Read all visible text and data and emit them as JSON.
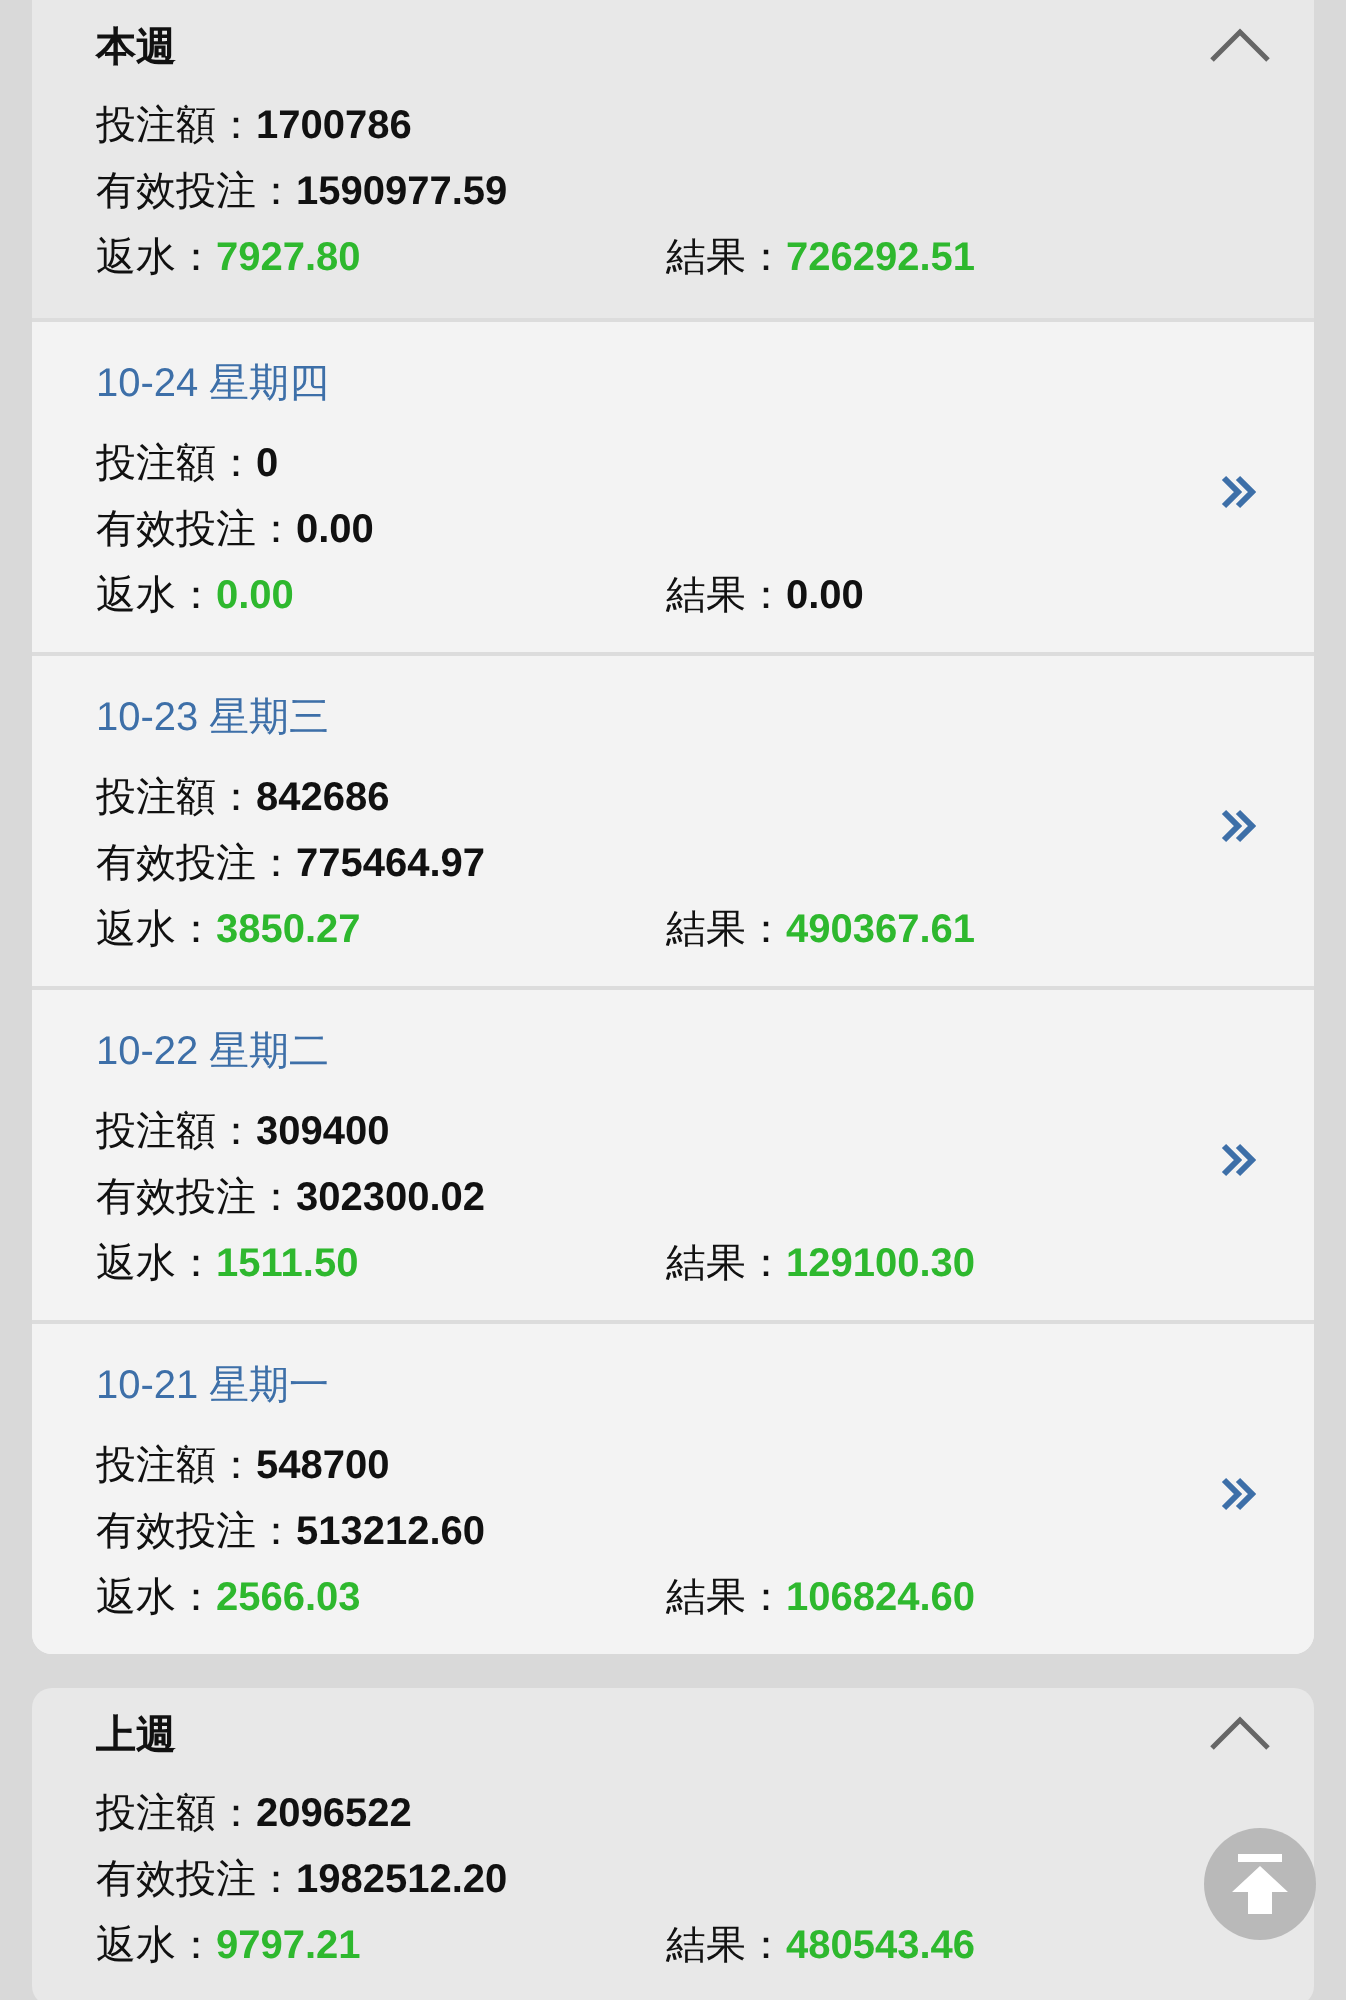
{
  "weeks": [
    {
      "title": "本週",
      "expanded": true,
      "summary": [
        [
          {
            "label": "投注額：",
            "value": "1700786",
            "color": "#111111"
          }
        ],
        [
          {
            "label": "有效投注：",
            "value": "1590977.59",
            "color": "#111111"
          }
        ],
        [
          {
            "label": "返水：",
            "value": "7927.80",
            "color": "#2eb82e"
          },
          {
            "label": "結果：",
            "value": "726292.51",
            "color": "#2eb82e"
          }
        ]
      ],
      "days": [
        {
          "date": "10-24 星期四",
          "rows": [
            [
              {
                "label": "投注額：",
                "value": "0",
                "color": "#111111"
              }
            ],
            [
              {
                "label": "有效投注：",
                "value": "0.00",
                "color": "#111111"
              }
            ],
            [
              {
                "label": "返水：",
                "value": "0.00",
                "color": "#2eb82e"
              },
              {
                "label": "結果：",
                "value": "0.00",
                "color": "#111111"
              }
            ]
          ]
        },
        {
          "date": "10-23 星期三",
          "rows": [
            [
              {
                "label": "投注額：",
                "value": "842686",
                "color": "#111111"
              }
            ],
            [
              {
                "label": "有效投注：",
                "value": "775464.97",
                "color": "#111111"
              }
            ],
            [
              {
                "label": "返水：",
                "value": "3850.27",
                "color": "#2eb82e"
              },
              {
                "label": "結果：",
                "value": "490367.61",
                "color": "#2eb82e"
              }
            ]
          ]
        },
        {
          "date": "10-22 星期二",
          "rows": [
            [
              {
                "label": "投注額：",
                "value": "309400",
                "color": "#111111"
              }
            ],
            [
              {
                "label": "有效投注：",
                "value": "302300.02",
                "color": "#111111"
              }
            ],
            [
              {
                "label": "返水：",
                "value": "1511.50",
                "color": "#2eb82e"
              },
              {
                "label": "結果：",
                "value": "129100.30",
                "color": "#2eb82e"
              }
            ]
          ]
        },
        {
          "date": "10-21 星期一",
          "rows": [
            [
              {
                "label": "投注額：",
                "value": "548700",
                "color": "#111111"
              }
            ],
            [
              {
                "label": "有效投注：",
                "value": "513212.60",
                "color": "#111111"
              }
            ],
            [
              {
                "label": "返水：",
                "value": "2566.03",
                "color": "#2eb82e"
              },
              {
                "label": "結果：",
                "value": "106824.60",
                "color": "#2eb82e"
              }
            ]
          ]
        }
      ]
    },
    {
      "title": "上週",
      "expanded": true,
      "summary": [
        [
          {
            "label": "投注額：",
            "value": "2096522",
            "color": "#111111"
          }
        ],
        [
          {
            "label": "有效投注：",
            "value": "1982512.20",
            "color": "#111111"
          }
        ],
        [
          {
            "label": "返水：",
            "value": "9797.21",
            "color": "#2eb82e"
          },
          {
            "label": "結果：",
            "value": "480543.46",
            "color": "#2eb82e"
          }
        ]
      ]
    }
  ]
}
